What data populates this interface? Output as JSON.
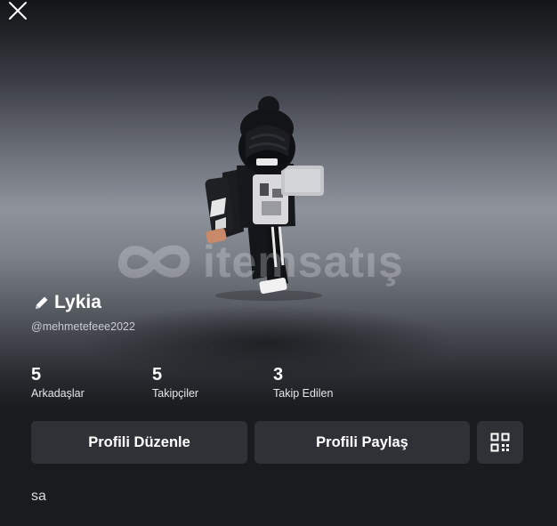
{
  "profile": {
    "display_name": "Lykia",
    "username": "@mehmetefeee2022",
    "bio": "sa"
  },
  "stats": [
    {
      "value": "5",
      "label": "Arkadaşlar"
    },
    {
      "value": "5",
      "label": "Takipçiler"
    },
    {
      "value": "3",
      "label": "Takip Edilen"
    }
  ],
  "actions": {
    "edit_label": "Profili Düzenle",
    "share_label": "Profili Paylaş"
  },
  "icons": {
    "close": "close-icon",
    "edit": "pencil-icon",
    "qr": "qr-code-icon"
  },
  "watermark": {
    "text": "itemsatış"
  },
  "colors": {
    "background": "#1a1b1e",
    "button": "#2f3136",
    "text": "#ffffff",
    "muted": "#c9ccd2"
  }
}
